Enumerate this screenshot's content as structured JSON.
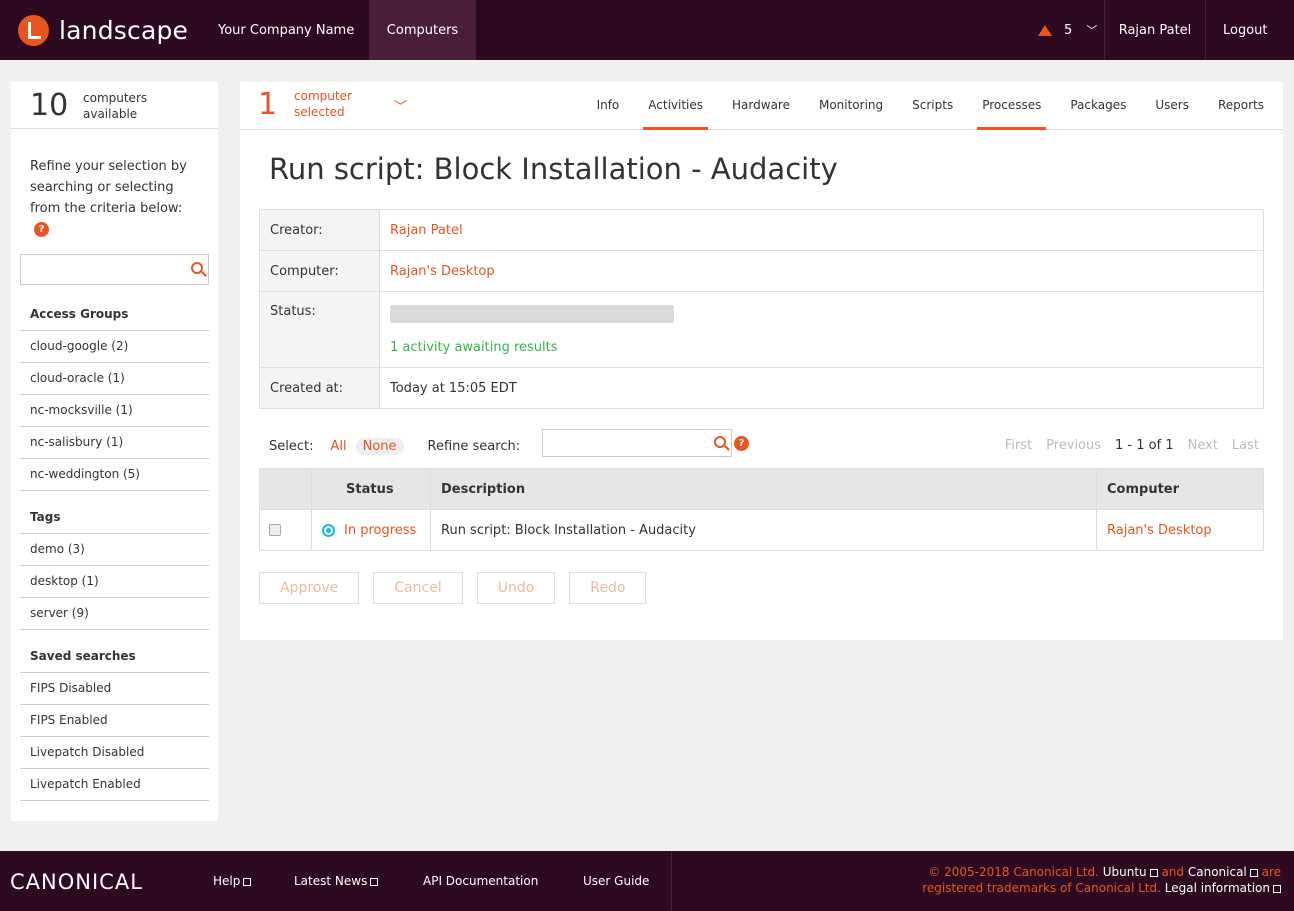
{
  "header": {
    "logo_text": "landscape",
    "company": "Your Company Name",
    "computers": "Computers",
    "alert_count": "5",
    "user": "Rajan Patel",
    "logout": "Logout"
  },
  "sidebar": {
    "count": "10",
    "count_label": "computers available",
    "refine_text": "Refine your selection by searching or selecting from the criteria below:",
    "search_placeholder": "",
    "access_groups_title": "Access Groups",
    "access_groups": [
      "cloud-google (2)",
      "cloud-oracle (1)",
      "nc-mocksville (1)",
      "nc-salisbury (1)",
      "nc-weddington (5)"
    ],
    "tags_title": "Tags",
    "tags": [
      "demo (3)",
      "desktop (1)",
      "server (9)"
    ],
    "saved_title": "Saved searches",
    "saved": [
      "FIPS Disabled",
      "FIPS Enabled",
      "Livepatch Disabled",
      "Livepatch Enabled"
    ]
  },
  "main": {
    "selected_count": "1",
    "selected_label": "computer selected",
    "tabs": [
      "Info",
      "Activities",
      "Hardware",
      "Monitoring",
      "Scripts",
      "Processes",
      "Packages",
      "Users",
      "Reports"
    ],
    "title": "Run script: Block Installation - Audacity",
    "info": {
      "creator_label": "Creator:",
      "creator": "Rajan Patel",
      "computer_label": "Computer:",
      "computer": "Rajan's Desktop",
      "status_label": "Status:",
      "status_text": "1 activity awaiting results",
      "progress": 0,
      "created_label": "Created at:",
      "created": "Today at 15:05 EDT"
    },
    "select_label": "Select:",
    "select_all": "All",
    "select_none": "None",
    "refine_label": "Refine search:",
    "pager": {
      "first": "First",
      "previous": "Previous",
      "range": "1 - 1 of 1",
      "next": "Next",
      "last": "Last"
    },
    "columns": [
      "Status",
      "Description",
      "Computer"
    ],
    "row": {
      "status": "In progress",
      "description": "Run script: Block Installation - Audacity",
      "computer": "Rajan's Desktop"
    },
    "buttons": {
      "approve": "Approve",
      "cancel": "Cancel",
      "undo": "Undo",
      "redo": "Redo"
    }
  },
  "footer": {
    "brand": "CANONICAL",
    "help": "Help",
    "news": "Latest News",
    "api": "API Documentation",
    "guide": "User Guide",
    "copyright": "© 2005-2018 Canonical Ltd.",
    "ubuntu": "Ubuntu",
    "and": "and",
    "canonical": "Canonical",
    "are": "are",
    "registered": "registered trademarks of Canonical Ltd.",
    "legal": "Legal information"
  },
  "colors": {
    "accent": "#e95420",
    "header_bg": "#2d0a22",
    "success": "#38b44a",
    "info": "#19b6ee"
  }
}
